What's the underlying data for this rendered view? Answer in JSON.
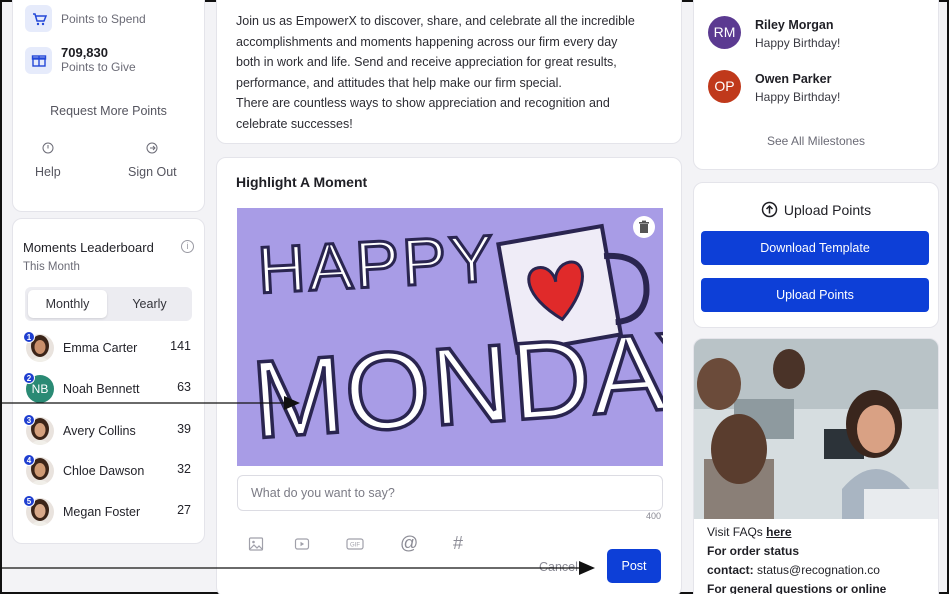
{
  "left_panel": {
    "points_to_spend_label": "Points to Spend",
    "points_to_give_value": "709,830",
    "points_to_give_label": "Points to Give",
    "request_more": "Request More Points",
    "help": "Help",
    "sign_out": "Sign Out"
  },
  "leaderboard": {
    "title": "Moments Leaderboard",
    "subtitle": "This Month",
    "tabs": [
      "Monthly",
      "Yearly"
    ],
    "rows": [
      {
        "rank": "1",
        "name": "Emma Carter",
        "score": "141",
        "initials": ""
      },
      {
        "rank": "2",
        "name": "Noah Bennett",
        "score": "63",
        "initials": "NB"
      },
      {
        "rank": "3",
        "name": "Avery Collins",
        "score": "39",
        "initials": ""
      },
      {
        "rank": "4",
        "name": "Chloe Dawson",
        "score": "32",
        "initials": ""
      },
      {
        "rank": "5",
        "name": "Megan Foster",
        "score": "27",
        "initials": ""
      }
    ]
  },
  "intro": {
    "lines": [
      "Join us as EmpowerX to discover, share, and celebrate all the incredible",
      "accomplishments and moments happening across our firm every day",
      "both in work and life. Send and receive appreciation for great results,",
      "performance, and attitudes that help make our firm special.",
      "There are countless ways to show appreciation and recognition and",
      "celebrate successes!"
    ]
  },
  "moment": {
    "title": "Highlight A Moment",
    "image_text_1": "HAPPY",
    "image_text_2": "MONDAY",
    "input_placeholder": "What do you want to say?",
    "char_count": "400",
    "cancel": "Cancel",
    "post": "Post",
    "toolbar_icons": [
      "image-icon",
      "video-icon",
      "gif-icon",
      "mention-icon",
      "hashtag-icon"
    ],
    "gif_label": "GIF"
  },
  "milestones": {
    "items": [
      {
        "initials": "RM",
        "name": "Riley Morgan",
        "message": "Happy Birthday!",
        "color": "#5b3a91"
      },
      {
        "initials": "OP",
        "name": "Owen Parker",
        "message": "Happy Birthday!",
        "color": "#c0391b"
      }
    ],
    "see_all": "See All Milestones"
  },
  "upload": {
    "title": "Upload Points",
    "download_template": "Download Template",
    "upload_points": "Upload Points"
  },
  "support": {
    "visit_faqs": "Visit FAQs",
    "here": "here",
    "order_status_label": "For order status",
    "contact_label": "contact:",
    "contact_email": "status@recognation.co",
    "general_questions": "For general questions or online"
  },
  "colors": {
    "primary_blue": "#0d3fd7",
    "image_bg": "#a89ce6"
  }
}
